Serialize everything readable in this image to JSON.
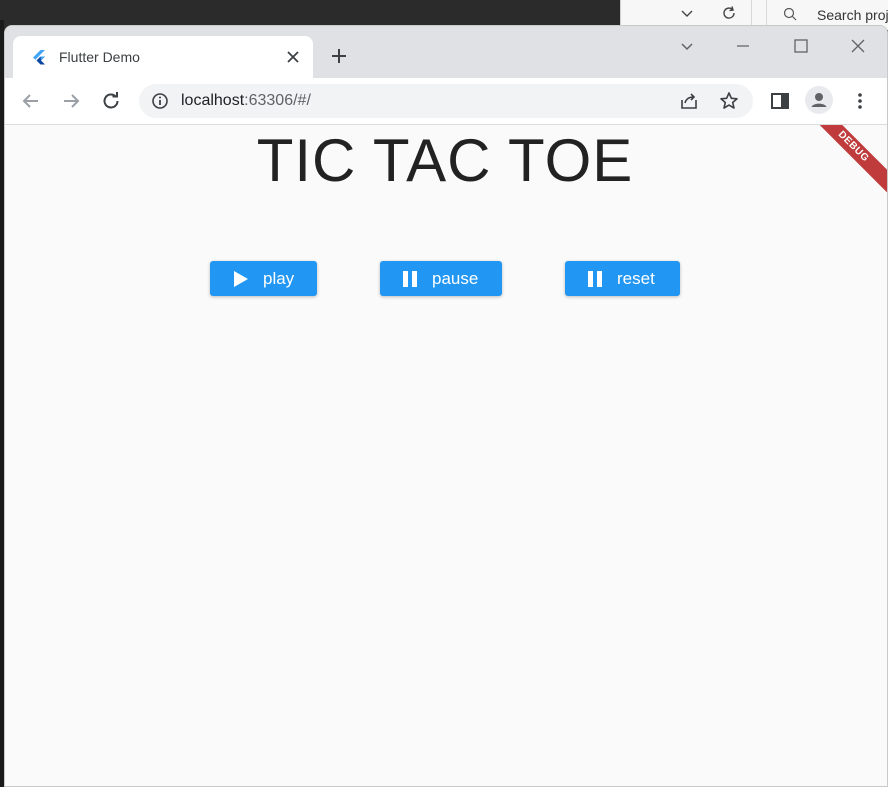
{
  "background_window": {
    "search_placeholder": "Search proj"
  },
  "browser": {
    "tab": {
      "title": "Flutter Demo"
    },
    "address": {
      "host": "localhost",
      "rest": ":63306/#/"
    }
  },
  "app": {
    "title": "TIC TAC TOE",
    "debug_banner": "DEBUG",
    "buttons": {
      "play": "play",
      "pause": "pause",
      "reset": "reset"
    },
    "accent_color": "#2196f3"
  }
}
